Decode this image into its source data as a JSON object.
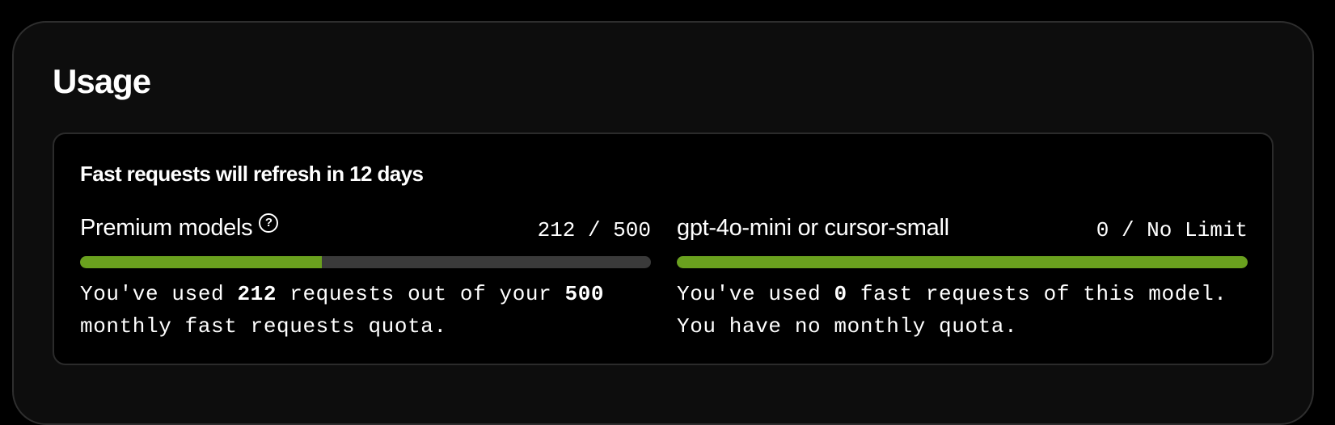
{
  "usage": {
    "title": "Usage",
    "refresh_text": "Fast requests will refresh in 12 days",
    "premium": {
      "label": "Premium models",
      "help_icon": "?",
      "count_text": "212 / 500",
      "used": 212,
      "quota": 500,
      "progress_fraction": 0.424,
      "desc_part1": "You've used ",
      "desc_used": "212",
      "desc_part2": " requests out of your ",
      "desc_quota": "500",
      "desc_part3": " monthly fast requests quota."
    },
    "mini": {
      "label": "gpt-4o-mini or cursor-small",
      "count_text": "0 / No Limit",
      "used": 0,
      "progress_fraction": 1.0,
      "desc_part1": "You've used ",
      "desc_used": "0",
      "desc_part2": " fast requests of this model. You have no monthly quota."
    },
    "colors": {
      "accent": "#6aa11e",
      "track": "#3a3a3a",
      "card_bg": "#0d0d0d",
      "panel_bg": "#000000",
      "text": "#ffffff"
    }
  }
}
